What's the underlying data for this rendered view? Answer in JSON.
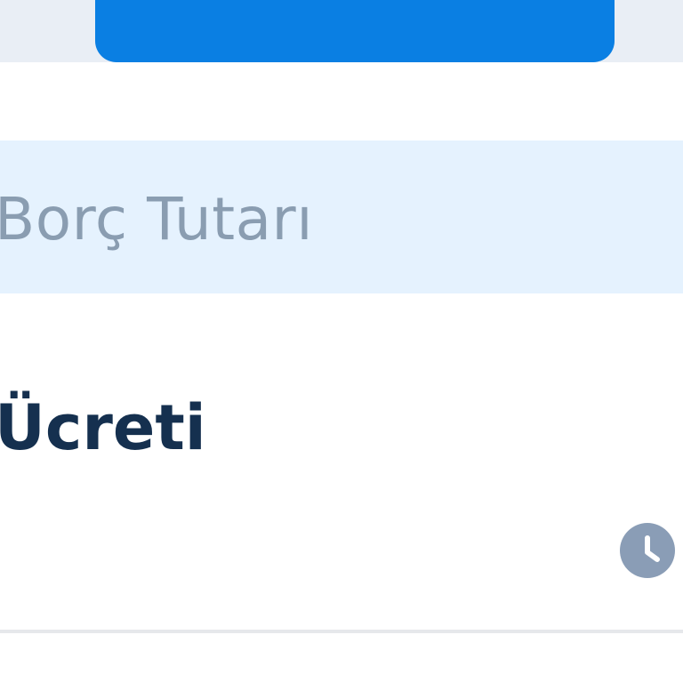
{
  "colors": {
    "primary": "#0a7fe3",
    "field_background": "#e5f2fe",
    "placeholder": "#8a9db1",
    "title": "#15304f",
    "icon": "#8a9db6"
  },
  "amount_field": {
    "placeholder": "Borç Tutarı"
  },
  "fee_section": {
    "title": "Ücreti"
  },
  "icons": {
    "status": "clock-icon"
  }
}
